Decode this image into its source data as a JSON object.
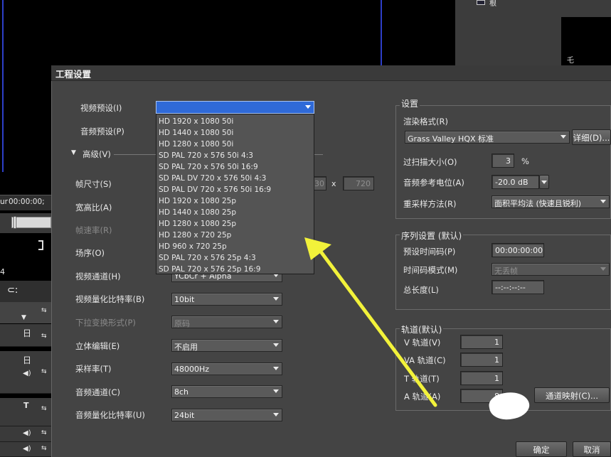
{
  "background": {
    "timecode": "00:00:00;",
    "timecode_prefix": "ur",
    "track_num": "4",
    "right_panel_label": "根",
    "right_preview_mark": "乇",
    "track_glyphs": [
      "日",
      "日",
      "T"
    ]
  },
  "dialog": {
    "title": "工程设置",
    "left": {
      "video_preset_label": "视频预设(I)",
      "audio_preset_label": "音频预设(P)",
      "advanced_label": "高级(V)",
      "frame_size_label": "帧尺寸(S)",
      "frame_w": "30",
      "frame_x": "x",
      "frame_h": "720",
      "aspect_label": "宽高比(A)",
      "frame_rate_label": "帧速率(R)",
      "field_order_label": "场序(O)",
      "video_channel_label": "视频通道(H)",
      "video_channel_value": "YCbCr + Alpha",
      "video_quant_label": "视频量化比特率(B)",
      "video_quant_value": "10bit",
      "pulldown_label": "下拉变换形式(P)",
      "pulldown_value": "原码",
      "stereo_label": "立体编辑(E)",
      "stereo_value": "不启用",
      "sample_rate_label": "采样率(T)",
      "sample_rate_value": "48000Hz",
      "audio_channel_label": "音频通道(C)",
      "audio_channel_value": "8ch",
      "audio_quant_label": "音频量化比特率(U)",
      "audio_quant_value": "24bit",
      "video_preset_value": ""
    },
    "dropdown_options": [
      "HD 1920 x 1080 50i",
      "HD 1440 x 1080 50i",
      "HD 1280 x 1080 50i",
      "SD PAL 720 x 576 50i 4:3",
      "SD PAL 720 x 576 50i 16:9",
      "SD PAL DV 720 x 576 50i 4:3",
      "SD PAL DV 720 x 576 50i 16:9",
      "HD 1920 x 1080 25p",
      "HD 1440 x 1080 25p",
      "HD 1280 x 1080 25p",
      "HD 1280 x 720 25p",
      "HD 960 x 720 25p",
      "SD PAL 720 x 576 25p 4:3",
      "SD PAL 720 x 576 25p 16:9"
    ],
    "settings": {
      "title": "设置",
      "render_format_label": "渲染格式(R)",
      "render_format_value": "Grass Valley HQX 标准",
      "detail_button": "详细(D)...",
      "overscan_label": "过扫描大小(O)",
      "overscan_value": "3",
      "overscan_unit": "%",
      "audio_ref_label": "音频参考电位(A)",
      "audio_ref_value": "-20.0 dB",
      "resample_label": "重采样方法(R)",
      "resample_value": "面积平均法 (快速且锐利)"
    },
    "sequence": {
      "title": "序列设置 (默认)",
      "preset_tc_label": "预设时间码(P)",
      "preset_tc_value": "00:00:00:00",
      "tc_mode_label": "时间码模式(M)",
      "tc_mode_value": "无丢帧",
      "duration_label": "总长度(L)",
      "duration_value": "--:--:--:--"
    },
    "tracks": {
      "title": "轨道(默认)",
      "v_label": "V 轨道(V)",
      "v_value": "1",
      "va_label": "VA 轨道(C)",
      "va_value": "1",
      "t_label": "T 轨道(T)",
      "t_value": "1",
      "a_label": "A 轨道(A)",
      "a_value": "8",
      "channel_map_button": "通道映射(C)..."
    },
    "ok_button": "确定",
    "cancel_button": "取消"
  },
  "colors": {
    "dialog_bg": "#444444",
    "highlight": "#3a6fd8",
    "arrow": "#f2f23a"
  }
}
